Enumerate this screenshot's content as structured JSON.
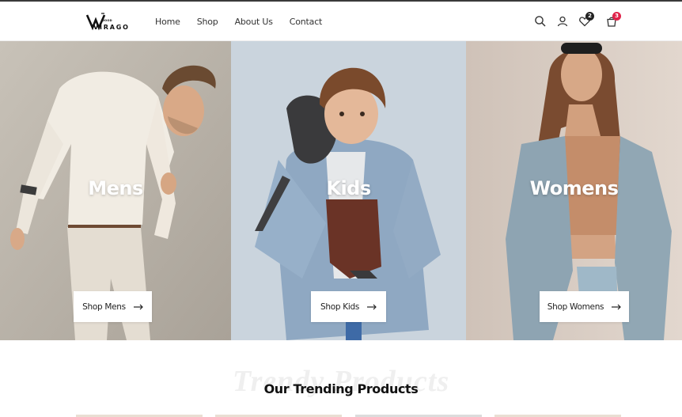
{
  "brand": {
    "logo_letters": "VIRAGO",
    "logo_sub": "WOOD"
  },
  "nav": {
    "items": [
      "Home",
      "Shop",
      "About Us",
      "Contact"
    ]
  },
  "header_icons": {
    "search": "search-icon",
    "account": "user-icon",
    "wishlist": "heart-icon",
    "cart": "cart-icon",
    "wishlist_count": "2",
    "cart_count": "3",
    "wishlist_badge_color": "#222222",
    "cart_badge_color": "#e0234a"
  },
  "banners": [
    {
      "title": "Mens",
      "button": "Shop Mens",
      "bg": "#bdb6ac"
    },
    {
      "title": "Kids",
      "button": "Shop Kids",
      "bg": "#c9d3dc"
    },
    {
      "title": "Womens",
      "button": "Shop Womens",
      "bg": "#d9cdc4"
    }
  ],
  "trending": {
    "ghost_title": "Trendy Products",
    "title": "Our Trending Products"
  }
}
